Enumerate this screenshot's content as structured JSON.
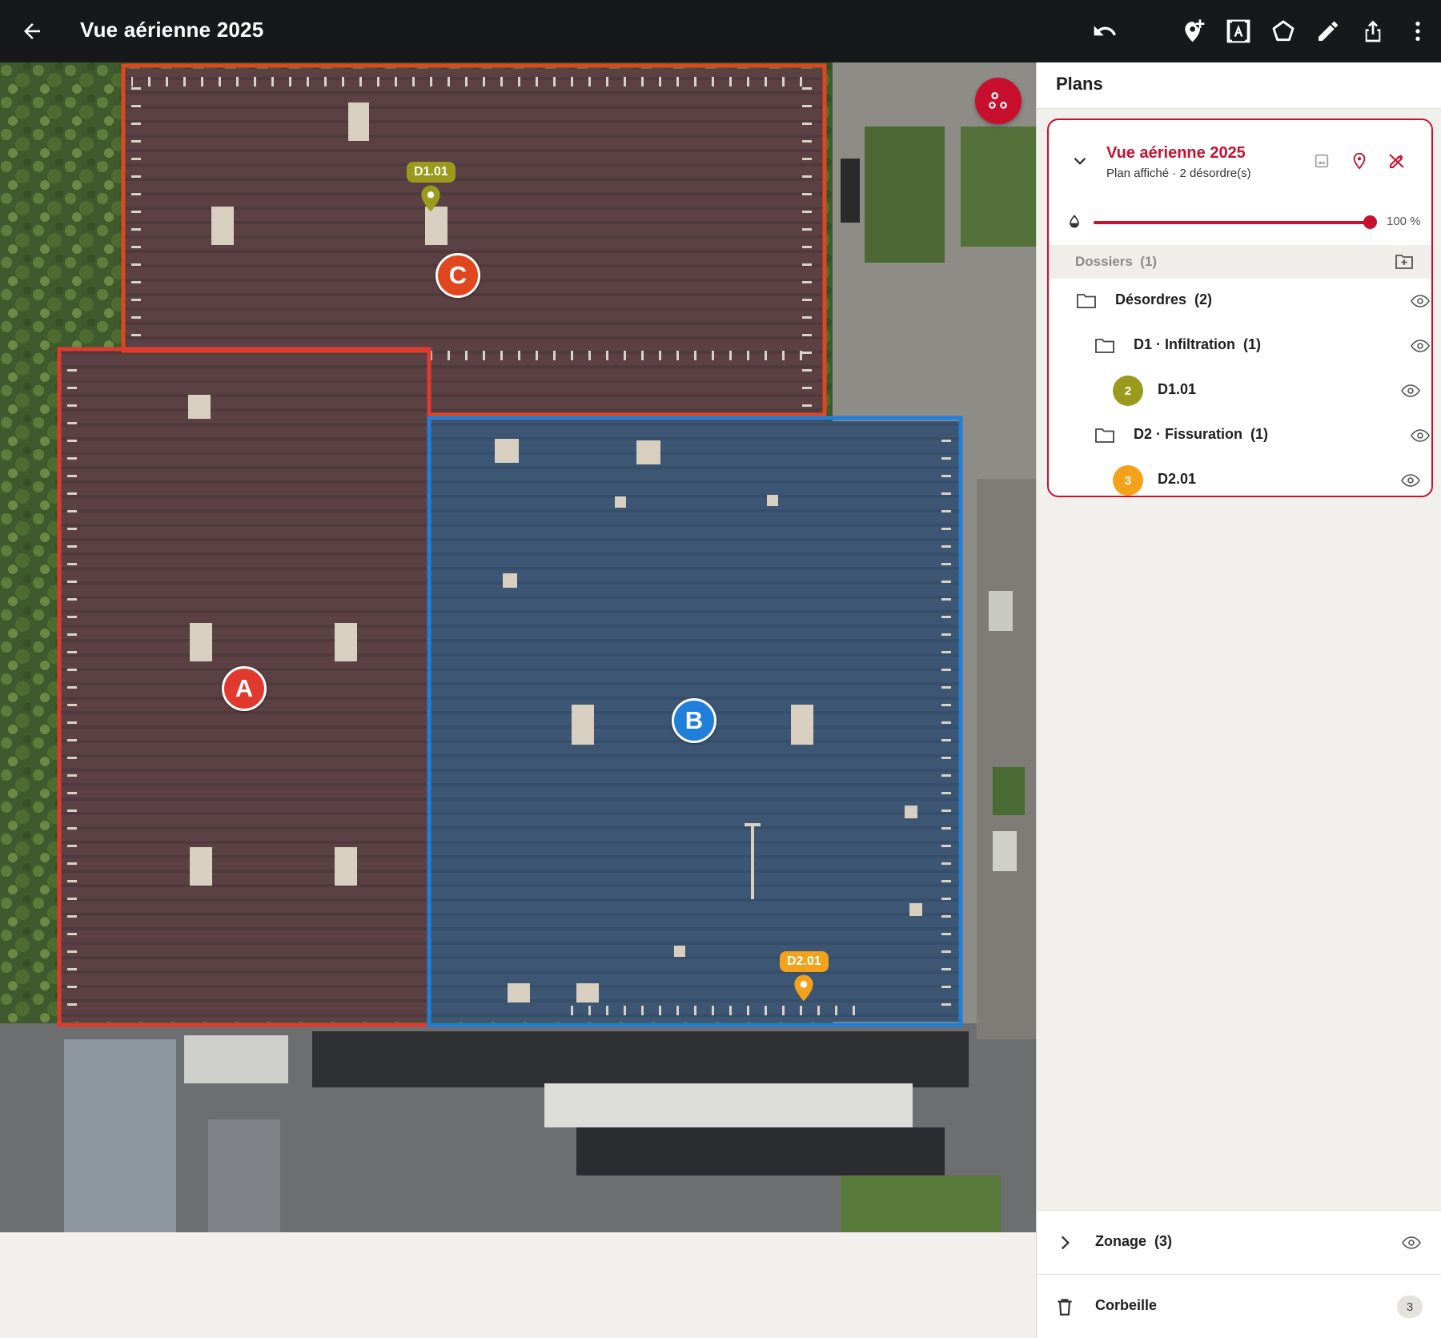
{
  "app": {
    "title": "Vue aérienne 2025"
  },
  "toolbar": {
    "icons": [
      "back-arrow-icon",
      "undo-icon",
      "add-marker-icon",
      "text-frame-icon",
      "polygon-icon",
      "pencil-icon",
      "share-icon",
      "more-vert-icon"
    ]
  },
  "map": {
    "zones": [
      {
        "letter": "A",
        "color": "#e03a2f"
      },
      {
        "letter": "B",
        "color": "#1f7fd9"
      },
      {
        "letter": "C",
        "color": "#e1471f"
      }
    ],
    "pins": [
      {
        "label": "D1.01",
        "color": "#9a9a1c"
      },
      {
        "label": "D2.01",
        "color": "#f3a21a"
      }
    ]
  },
  "panel": {
    "header": "Plans",
    "plan": {
      "title": "Vue aérienne 2025",
      "subtitle": "Plan affiché · 2 désordre(s)",
      "opacity": "100 %",
      "opacity_value": 1.0
    },
    "dossiers_label": "Dossiers  (1)",
    "tree": [
      {
        "label": "Désordres  (2)",
        "type": "folder",
        "depth": 0
      },
      {
        "label": "D1 · Infiltration  (1)",
        "type": "folder",
        "depth": 1
      },
      {
        "label": "D1.01",
        "type": "item",
        "number": "2",
        "color": "#9a9a1c",
        "depth": 2
      },
      {
        "label": "D2 · Fissuration  (1)",
        "type": "folder",
        "depth": 1
      },
      {
        "label": "D2.01",
        "type": "item",
        "number": "3",
        "color": "#f3a21a",
        "depth": 2
      }
    ],
    "zonage": {
      "label": "Zonage  (3)"
    },
    "corbeille": {
      "label": "Corbeille",
      "count": "3"
    }
  },
  "colors": {
    "accent": "#c8102e",
    "topbar": "#17181a"
  }
}
